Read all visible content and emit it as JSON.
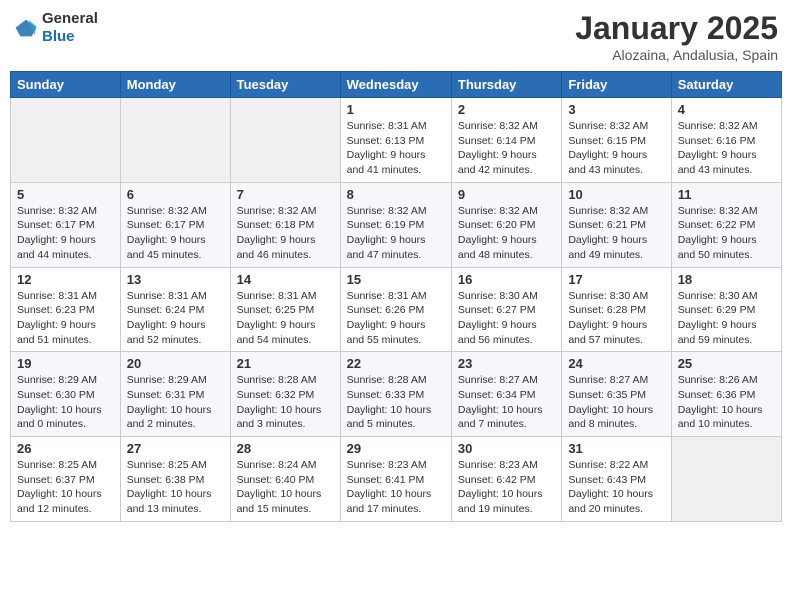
{
  "header": {
    "logo_general": "General",
    "logo_blue": "Blue",
    "month_title": "January 2025",
    "location": "Alozaina, Andalusia, Spain"
  },
  "weekdays": [
    "Sunday",
    "Monday",
    "Tuesday",
    "Wednesday",
    "Thursday",
    "Friday",
    "Saturday"
  ],
  "weeks": [
    [
      {
        "day": "",
        "content": ""
      },
      {
        "day": "",
        "content": ""
      },
      {
        "day": "",
        "content": ""
      },
      {
        "day": "1",
        "content": "Sunrise: 8:31 AM\nSunset: 6:13 PM\nDaylight: 9 hours\nand 41 minutes."
      },
      {
        "day": "2",
        "content": "Sunrise: 8:32 AM\nSunset: 6:14 PM\nDaylight: 9 hours\nand 42 minutes."
      },
      {
        "day": "3",
        "content": "Sunrise: 8:32 AM\nSunset: 6:15 PM\nDaylight: 9 hours\nand 43 minutes."
      },
      {
        "day": "4",
        "content": "Sunrise: 8:32 AM\nSunset: 6:16 PM\nDaylight: 9 hours\nand 43 minutes."
      }
    ],
    [
      {
        "day": "5",
        "content": "Sunrise: 8:32 AM\nSunset: 6:17 PM\nDaylight: 9 hours\nand 44 minutes."
      },
      {
        "day": "6",
        "content": "Sunrise: 8:32 AM\nSunset: 6:17 PM\nDaylight: 9 hours\nand 45 minutes."
      },
      {
        "day": "7",
        "content": "Sunrise: 8:32 AM\nSunset: 6:18 PM\nDaylight: 9 hours\nand 46 minutes."
      },
      {
        "day": "8",
        "content": "Sunrise: 8:32 AM\nSunset: 6:19 PM\nDaylight: 9 hours\nand 47 minutes."
      },
      {
        "day": "9",
        "content": "Sunrise: 8:32 AM\nSunset: 6:20 PM\nDaylight: 9 hours\nand 48 minutes."
      },
      {
        "day": "10",
        "content": "Sunrise: 8:32 AM\nSunset: 6:21 PM\nDaylight: 9 hours\nand 49 minutes."
      },
      {
        "day": "11",
        "content": "Sunrise: 8:32 AM\nSunset: 6:22 PM\nDaylight: 9 hours\nand 50 minutes."
      }
    ],
    [
      {
        "day": "12",
        "content": "Sunrise: 8:31 AM\nSunset: 6:23 PM\nDaylight: 9 hours\nand 51 minutes."
      },
      {
        "day": "13",
        "content": "Sunrise: 8:31 AM\nSunset: 6:24 PM\nDaylight: 9 hours\nand 52 minutes."
      },
      {
        "day": "14",
        "content": "Sunrise: 8:31 AM\nSunset: 6:25 PM\nDaylight: 9 hours\nand 54 minutes."
      },
      {
        "day": "15",
        "content": "Sunrise: 8:31 AM\nSunset: 6:26 PM\nDaylight: 9 hours\nand 55 minutes."
      },
      {
        "day": "16",
        "content": "Sunrise: 8:30 AM\nSunset: 6:27 PM\nDaylight: 9 hours\nand 56 minutes."
      },
      {
        "day": "17",
        "content": "Sunrise: 8:30 AM\nSunset: 6:28 PM\nDaylight: 9 hours\nand 57 minutes."
      },
      {
        "day": "18",
        "content": "Sunrise: 8:30 AM\nSunset: 6:29 PM\nDaylight: 9 hours\nand 59 minutes."
      }
    ],
    [
      {
        "day": "19",
        "content": "Sunrise: 8:29 AM\nSunset: 6:30 PM\nDaylight: 10 hours\nand 0 minutes."
      },
      {
        "day": "20",
        "content": "Sunrise: 8:29 AM\nSunset: 6:31 PM\nDaylight: 10 hours\nand 2 minutes."
      },
      {
        "day": "21",
        "content": "Sunrise: 8:28 AM\nSunset: 6:32 PM\nDaylight: 10 hours\nand 3 minutes."
      },
      {
        "day": "22",
        "content": "Sunrise: 8:28 AM\nSunset: 6:33 PM\nDaylight: 10 hours\nand 5 minutes."
      },
      {
        "day": "23",
        "content": "Sunrise: 8:27 AM\nSunset: 6:34 PM\nDaylight: 10 hours\nand 7 minutes."
      },
      {
        "day": "24",
        "content": "Sunrise: 8:27 AM\nSunset: 6:35 PM\nDaylight: 10 hours\nand 8 minutes."
      },
      {
        "day": "25",
        "content": "Sunrise: 8:26 AM\nSunset: 6:36 PM\nDaylight: 10 hours\nand 10 minutes."
      }
    ],
    [
      {
        "day": "26",
        "content": "Sunrise: 8:25 AM\nSunset: 6:37 PM\nDaylight: 10 hours\nand 12 minutes."
      },
      {
        "day": "27",
        "content": "Sunrise: 8:25 AM\nSunset: 6:38 PM\nDaylight: 10 hours\nand 13 minutes."
      },
      {
        "day": "28",
        "content": "Sunrise: 8:24 AM\nSunset: 6:40 PM\nDaylight: 10 hours\nand 15 minutes."
      },
      {
        "day": "29",
        "content": "Sunrise: 8:23 AM\nSunset: 6:41 PM\nDaylight: 10 hours\nand 17 minutes."
      },
      {
        "day": "30",
        "content": "Sunrise: 8:23 AM\nSunset: 6:42 PM\nDaylight: 10 hours\nand 19 minutes."
      },
      {
        "day": "31",
        "content": "Sunrise: 8:22 AM\nSunset: 6:43 PM\nDaylight: 10 hours\nand 20 minutes."
      },
      {
        "day": "",
        "content": ""
      }
    ]
  ]
}
